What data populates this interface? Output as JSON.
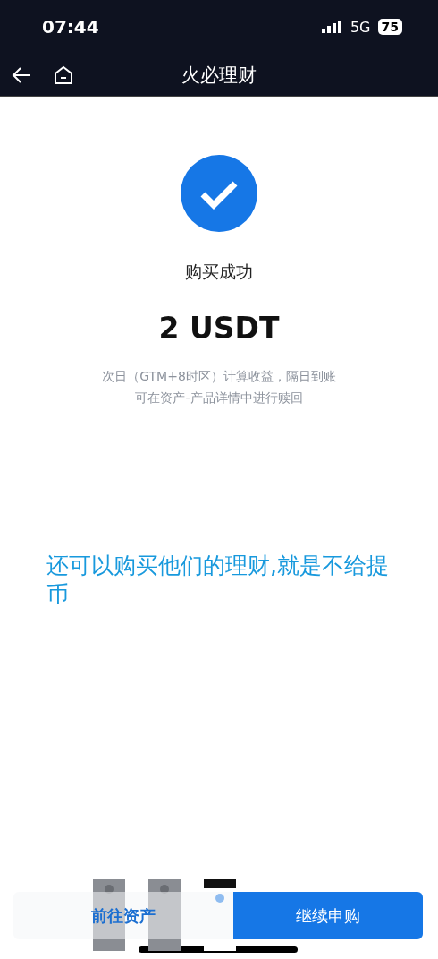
{
  "status_bar": {
    "time": "07:44",
    "network": "5G",
    "battery": "75"
  },
  "header": {
    "title": "火必理财"
  },
  "result": {
    "status": "购买成功",
    "amount": "2 USDT",
    "notes": [
      "次日（GTM+8时区）计算收益，隔日到账",
      "可在资产-产品详情中进行赎回"
    ]
  },
  "annotation": "还可以购买他们的理财,就是不给提币",
  "buttons": [
    {
      "label": "前往资产",
      "kind": "secondary"
    },
    {
      "label": "继续申购",
      "kind": "primary"
    }
  ],
  "thumbnails": [
    {
      "kind": "dark"
    },
    {
      "kind": "dark"
    },
    {
      "kind": "light"
    }
  ]
}
